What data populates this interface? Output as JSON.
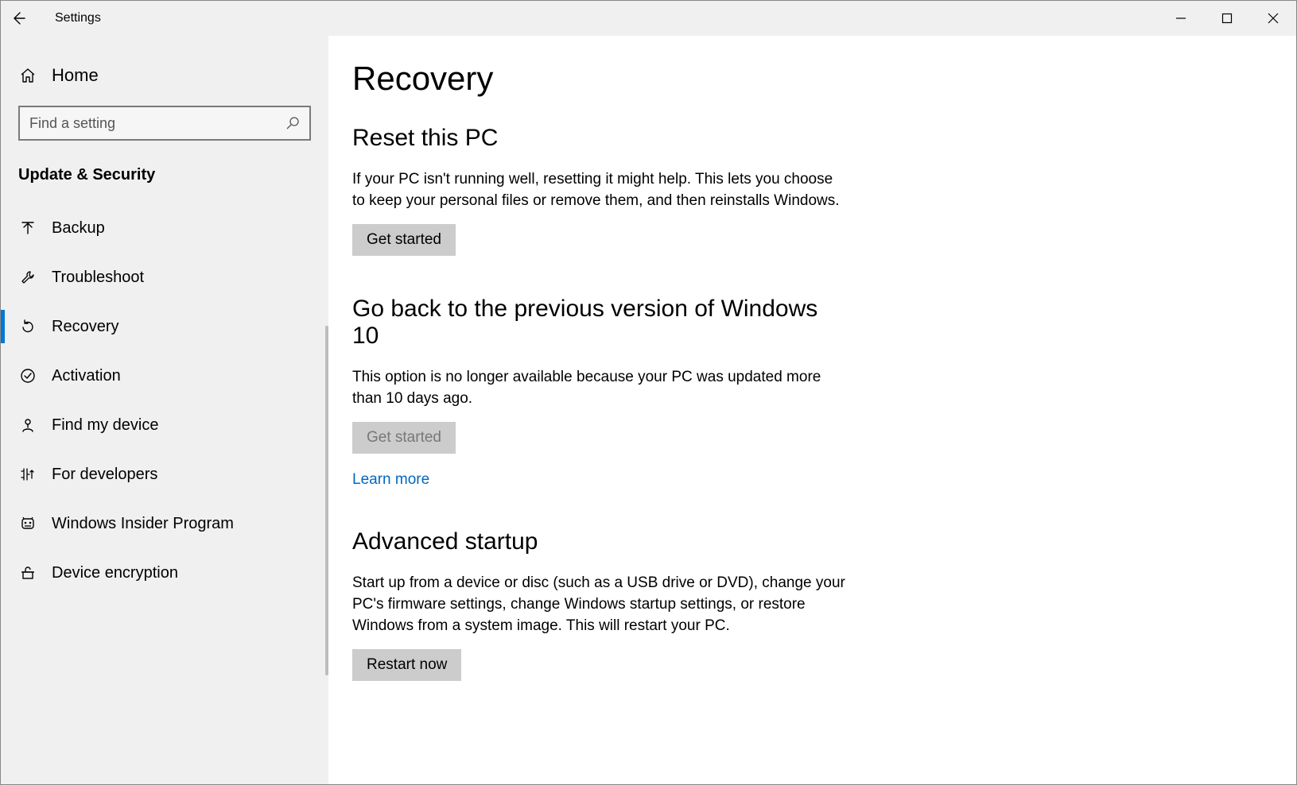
{
  "window": {
    "title": "Settings"
  },
  "sidebar": {
    "home_label": "Home",
    "search_placeholder": "Find a setting",
    "category": "Update & Security",
    "items": [
      {
        "label": "Backup",
        "icon": "backup-icon"
      },
      {
        "label": "Troubleshoot",
        "icon": "wrench-icon"
      },
      {
        "label": "Recovery",
        "icon": "recovery-icon",
        "selected": true
      },
      {
        "label": "Activation",
        "icon": "check-circle-icon"
      },
      {
        "label": "Find my device",
        "icon": "find-device-icon"
      },
      {
        "label": "For developers",
        "icon": "developers-icon"
      },
      {
        "label": "Windows Insider Program",
        "icon": "insider-icon"
      },
      {
        "label": "Device encryption",
        "icon": "lock-icon"
      }
    ]
  },
  "main": {
    "title": "Recovery",
    "sections": {
      "reset": {
        "heading": "Reset this PC",
        "body": "If your PC isn't running well, resetting it might help. This lets you choose to keep your personal files or remove them, and then reinstalls Windows.",
        "button": "Get started"
      },
      "goback": {
        "heading": "Go back to the previous version of Windows 10",
        "body": "This option is no longer available because your PC was updated more than 10 days ago.",
        "button": "Get started",
        "link": "Learn more"
      },
      "advanced": {
        "heading": "Advanced startup",
        "body": "Start up from a device or disc (such as a USB drive or DVD), change your PC's firmware settings, change Windows startup settings, or restore Windows from a system image. This will restart your PC.",
        "button": "Restart now"
      }
    }
  }
}
